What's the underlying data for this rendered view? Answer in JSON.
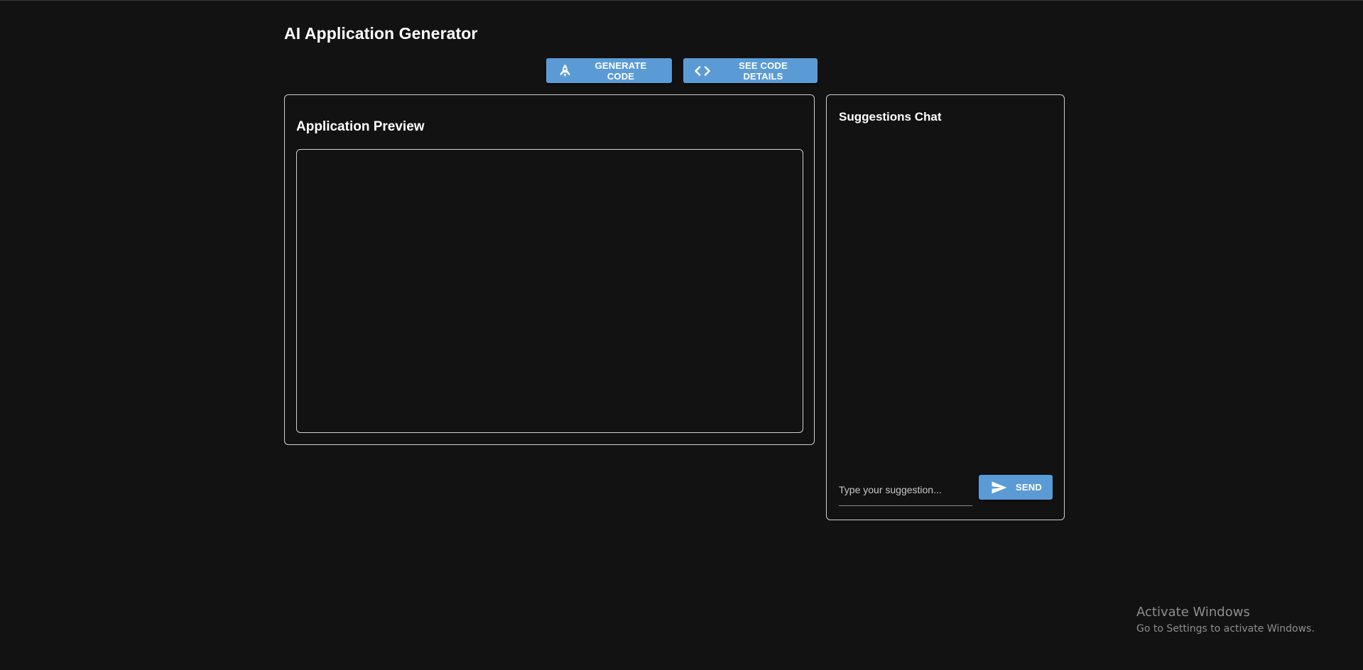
{
  "app": {
    "title": "AI Application Generator"
  },
  "toolbar": {
    "generate_label": "GENERATE CODE",
    "generate_icon": "rocket-icon",
    "details_label": "SEE CODE DETAILS",
    "details_icon": "code-icon"
  },
  "preview": {
    "title": "Application Preview"
  },
  "chat": {
    "title": "Suggestions Chat",
    "input_placeholder": "Type your suggestion...",
    "input_value": "",
    "send_label": "SEND",
    "send_icon": "send-icon"
  },
  "watermark": {
    "title": "Activate Windows",
    "subtitle": "Go to Settings to activate Windows."
  },
  "colors": {
    "background": "#121212",
    "accent": "#5b9bd5",
    "border": "#cfcfcf",
    "text": "#ffffff"
  }
}
